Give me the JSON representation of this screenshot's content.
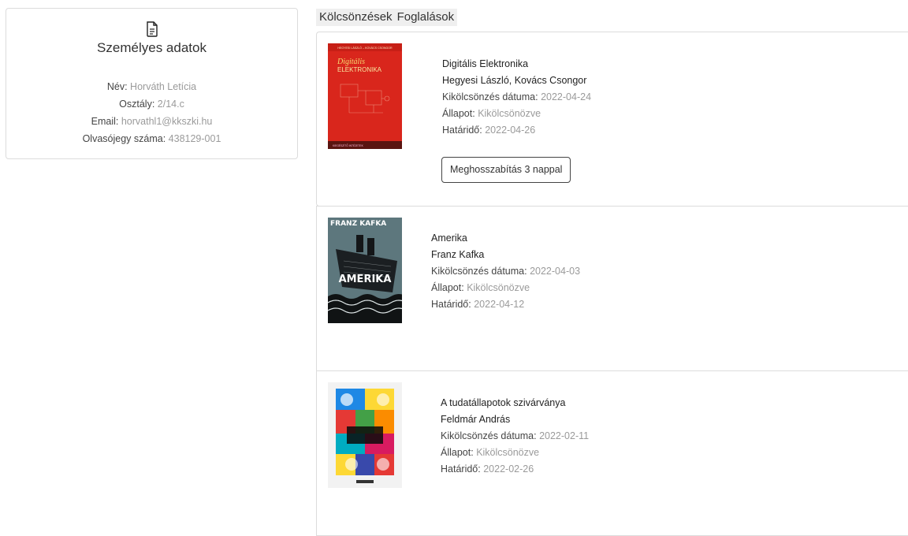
{
  "profile": {
    "title": "Személyes adatok",
    "name_label": "Név:",
    "name": "Horváth Letícia",
    "class_label": "Osztály:",
    "class": "2/14.c",
    "email_label": "Email:",
    "email": "horvathl1@kkszki.hu",
    "card_label": "Olvasójegy száma:",
    "card": "438129-001"
  },
  "tabs": [
    "Kölcsönzések",
    "Foglalások"
  ],
  "labels": {
    "loan_date": "Kikölcsönzés dátuma:",
    "status": "Állapot:",
    "due": "Határidő:"
  },
  "loans": [
    {
      "title": "Digitális Elektronika",
      "author": "Hegyesi László, Kovács Csongor",
      "loan_date": "2022-04-24",
      "status": "Kikölcsönözve",
      "due": "2022-04-26",
      "extend_button": "Meghosszabítás 3 nappal",
      "cover": {
        "top_text": "HEGYESI LÁSZLÓ – KOVÁCS CSONGOR",
        "script_text": "Digitális",
        "big_text": "ELEKTRONIKA",
        "footer": "KIEGÉSZÍTŐ INTÉZETEK"
      }
    },
    {
      "title": "Amerika",
      "author": "Franz Kafka",
      "loan_date": "2022-04-03",
      "status": "Kikölcsönözve",
      "due": "2022-04-12",
      "cover": {
        "top_text": "FRANZ KAFKA",
        "big_text": "AMERIKA"
      }
    },
    {
      "title": "A tudatállapotok szivárványa",
      "author": "Feldmár András",
      "loan_date": "2022-02-11",
      "status": "Kikölcsönözve",
      "due": "2022-02-26"
    }
  ],
  "colors": {
    "value_gray": "#9a9a9a",
    "border": "#dcdcdc",
    "tab_bg": "#efefef",
    "cover1": "#d9261c",
    "cover2": "#3b4a4f"
  }
}
